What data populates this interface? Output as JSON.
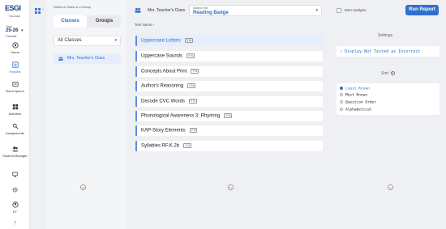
{
  "logo": {
    "text": "ESGI",
    "sub": "TEACHER"
  },
  "year": {
    "label": "Year",
    "value": "25-26",
    "status": "Current"
  },
  "nav": [
    {
      "label": "Home",
      "icon": "home-icon"
    },
    {
      "label": "Reports",
      "icon": "reports-icon"
    },
    {
      "label": "Test Explorer",
      "icon": "test-explorer-icon"
    },
    {
      "label": "Activities",
      "icon": "activities-icon"
    },
    {
      "label": "Assignments",
      "icon": "assignments-icon"
    },
    {
      "label": "Student Manager",
      "icon": "student-manager-icon"
    }
  ],
  "user_initials": "ET",
  "picker": {
    "label": "Select a Class or a Group",
    "tab_classes": "Classes",
    "tab_groups": "Groups",
    "filter": "All Classes",
    "class_item": "Mrs. Teacher's Class"
  },
  "header": {
    "class_name": "Mrs. Teacher's Class",
    "subject_label": "Subject Tab",
    "subject_value": "Reading Badge",
    "checkbox_label": "Item Analysis",
    "run_button": "Run Report"
  },
  "tests": {
    "column_header": "Test Name",
    "items": [
      {
        "name": "Uppercase Letters",
        "tag": "Y N"
      },
      {
        "name": "Uppercase Sounds",
        "tag": "Y N"
      },
      {
        "name": "Concepts About Print",
        "tag": "Y N"
      },
      {
        "name": "Author's Reasoning",
        "tag": "Y N"
      },
      {
        "name": "Decode CVC Words",
        "tag": "Y N"
      },
      {
        "name": "Phonological Awareness 3: Rhyming",
        "tag": "Y N"
      },
      {
        "name": "KAP-Story Elements",
        "tag": "Y N"
      },
      {
        "name": "Syllables RF.K.2b",
        "tag": "Y N"
      }
    ]
  },
  "settings": {
    "header": "Settings",
    "option": "Display Not Tested as Incorrect"
  },
  "sort": {
    "header": "Sort",
    "options": [
      "Least Known",
      "Most Known",
      "Question Order",
      "Alphabetical"
    ],
    "selected": "Least Known"
  },
  "callouts": [
    "a",
    "b",
    "c"
  ]
}
